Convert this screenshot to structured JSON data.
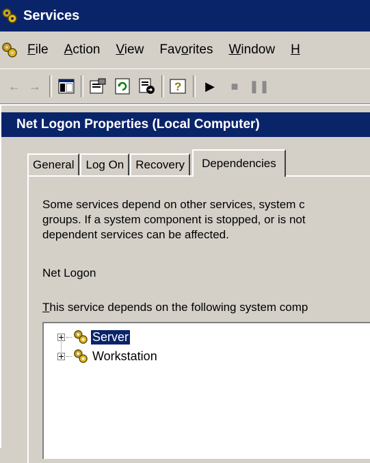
{
  "app": {
    "title": "Services"
  },
  "menu": {
    "items": [
      {
        "label": "File",
        "accel": "F",
        "rest": "ile"
      },
      {
        "label": "Action",
        "accel": "A",
        "rest": "ction"
      },
      {
        "label": "View",
        "accel": "V",
        "rest": "iew"
      },
      {
        "label": "Favorites",
        "pre": "Fav",
        "accel": "o",
        "rest": "rites"
      },
      {
        "label": "Window",
        "accel": "W",
        "rest": "indow"
      },
      {
        "label": "H",
        "accel": "H",
        "rest": ""
      }
    ]
  },
  "toolbar": {
    "icons": [
      "back-arrow-icon",
      "forward-arrow-icon",
      "show-hide-console-tree-icon",
      "properties-icon",
      "refresh-icon",
      "export-list-icon",
      "help-icon",
      "start-service-icon",
      "stop-service-icon",
      "pause-service-icon"
    ]
  },
  "dialog": {
    "title": "Net Logon Properties (Local Computer)",
    "tabs": [
      "General",
      "Log On",
      "Recovery",
      "Dependencies"
    ],
    "active_tab": "Dependencies",
    "desc_line1": "Some services depend on other services, system c",
    "desc_line2": "groups. If a system component is stopped, or is not",
    "desc_line3": "dependent services can be affected.",
    "service_name": "Net Logon",
    "depends_label_accel": "T",
    "depends_label_rest": "his service depends on the following system comp",
    "tree": [
      {
        "label": "Server",
        "selected": true
      },
      {
        "label": "Workstation",
        "selected": false
      }
    ]
  },
  "colors": {
    "titlebar": "#0a246a",
    "face": "#d4d0c8",
    "selection": "#0a246a"
  }
}
